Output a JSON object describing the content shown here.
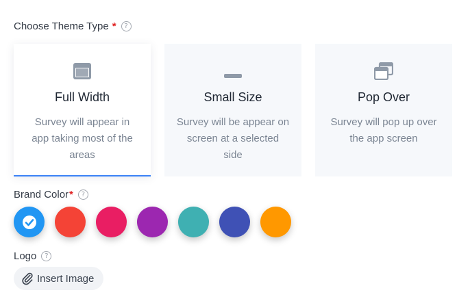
{
  "theme_type": {
    "label": "Choose Theme Type",
    "required_mark": "*",
    "help_icon": "question-circle-icon",
    "options": [
      {
        "title": "Full Width",
        "description": "Survey will appear in app taking most of the areas",
        "icon": "full-width-window-icon",
        "selected": true
      },
      {
        "title": "Small Size",
        "description": "Survey will be appear on screen at a selected side",
        "icon": "small-bar-icon",
        "selected": false
      },
      {
        "title": "Pop Over",
        "description": "Survey will pop up over the app screen",
        "icon": "stacked-windows-icon",
        "selected": false
      }
    ],
    "accent_color": "#3b82f6"
  },
  "brand_color": {
    "label": "Brand Color",
    "required_mark": "*",
    "help_icon": "question-circle-icon",
    "swatches": [
      {
        "color": "#2196f3",
        "selected": true
      },
      {
        "color": "#f44336",
        "selected": false
      },
      {
        "color": "#e91e63",
        "selected": false
      },
      {
        "color": "#9c27b0",
        "selected": false
      },
      {
        "color": "#3fb0b2",
        "selected": false
      },
      {
        "color": "#3f51b5",
        "selected": false
      },
      {
        "color": "#ff9800",
        "selected": false
      }
    ]
  },
  "logo": {
    "label": "Logo",
    "help_icon": "question-circle-icon",
    "insert_label": "Insert Image",
    "insert_icon": "paperclip-icon"
  }
}
